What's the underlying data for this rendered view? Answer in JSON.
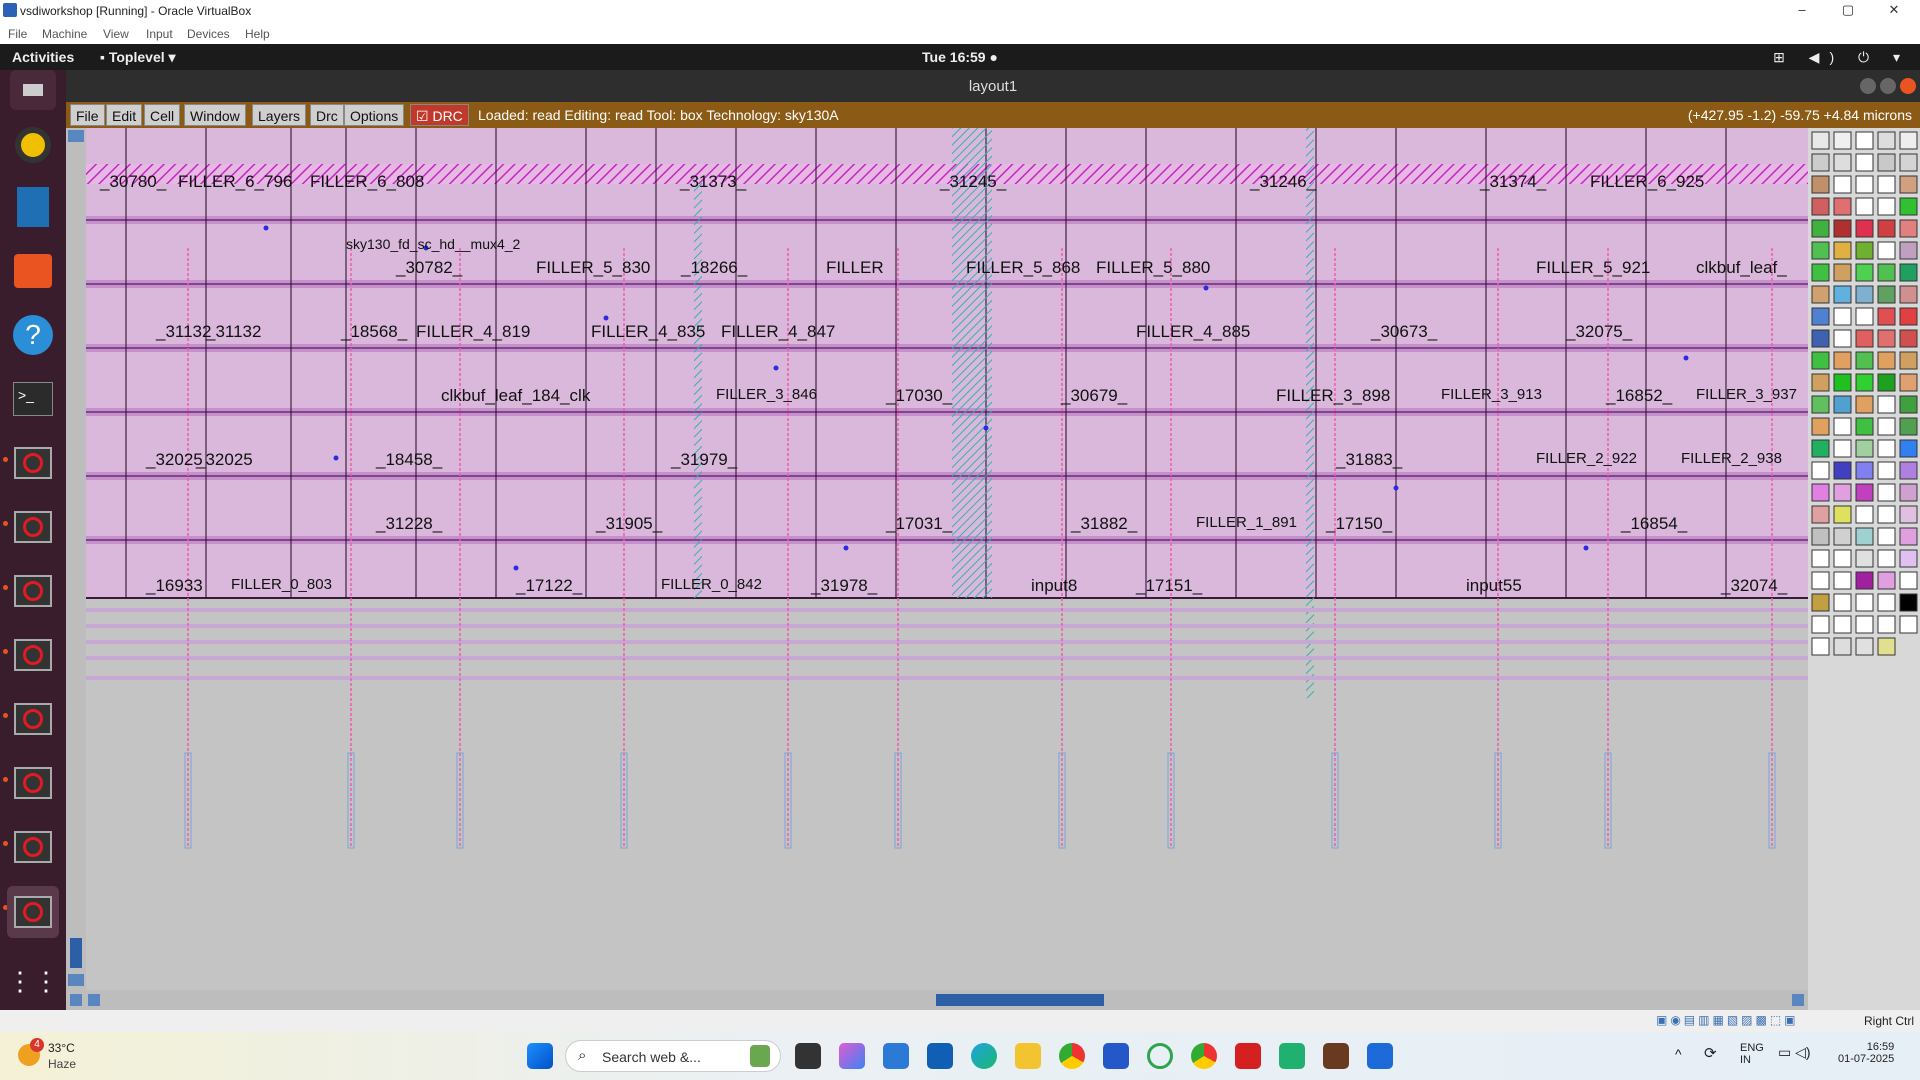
{
  "vbox": {
    "title": "vsdiworkshop [Running] - Oracle VirtualBox",
    "menu": [
      "File",
      "Machine",
      "View",
      "Input",
      "Devices",
      "Help"
    ],
    "host_key": "Right Ctrl"
  },
  "gnome": {
    "activities": "Activities",
    "toplevel": "Toplevel",
    "clock": "Tue 16:59"
  },
  "magic": {
    "window_title": "layout1",
    "menu": [
      "File",
      "Edit",
      "Cell",
      "Window",
      "Layers",
      "Drc",
      "Options"
    ],
    "drc_label": "DRC",
    "status": "Loaded: read Editing: read Tool: box  Technology: sky130A",
    "coords": "(+427.95 -1.2) -59.75 +4.84 microns"
  },
  "layout_rows": [
    [
      "_30780_",
      "FILLER_6_796",
      "FILLER_6_808",
      "_31373_",
      "_31245_",
      "_31246_",
      "_31374_",
      "FILLER_6_925"
    ],
    [
      "sky130_fd_sc_hd__mux4_2",
      "_30782_",
      "FILLER_5_830",
      "_18266_",
      "FILLER",
      "FILLER_5_868",
      "FILLER_5_880",
      "FILLER_5_921",
      "clkbuf_leaf_"
    ],
    [
      "_31132",
      "_31132",
      "_18568_",
      "FILLER_4_819",
      "FILLER_4_835",
      "FILLER_4_847",
      "FILLER_4_885",
      "_30673_",
      "_32075_"
    ],
    [
      "clkbuf_leaf_184_clk",
      "FILLER_3_846",
      "_17030_",
      "_30679_",
      "FILLER_3_898",
      "FILLER_3_913",
      "_16852_",
      "FILLER_3_937"
    ],
    [
      "_32025",
      "_32025",
      "_18458_",
      "_31979_",
      "_31883_",
      "FILLER_2_922",
      "FILLER_2_938"
    ],
    [
      "_31228_",
      "_31905_",
      "_17031_",
      "_31882_",
      "FILLER_1_891",
      "_17150_",
      "_16854_"
    ],
    [
      "_16933",
      "FILLER_0_803",
      "_17122_",
      "FILLER_0_842",
      "_31978_",
      "input8",
      "_17151_",
      "input55",
      "_32074_"
    ]
  ],
  "taskbar": {
    "weather_temp": "33°C",
    "weather_desc": "Haze",
    "search_placeholder": "Search web &...",
    "lang": "ENG",
    "region": "IN",
    "time": "16:59",
    "date": "01-07-2025",
    "weather_badge": "4"
  }
}
